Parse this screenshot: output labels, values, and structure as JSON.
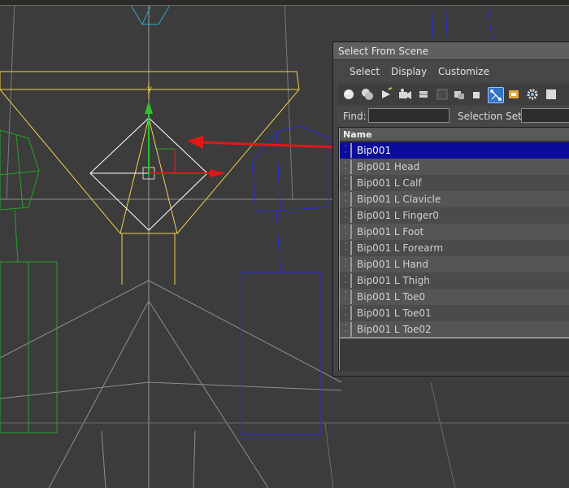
{
  "dialog": {
    "title": "Select From Scene",
    "menu": [
      "Select",
      "Display",
      "Customize"
    ],
    "find_label": "Find:",
    "find_value": "",
    "selection_set_label": "Selection Set:",
    "selection_set_value": "",
    "column_header": "Name",
    "rows": [
      "Bip001",
      "Bip001 Head",
      "Bip001 L Calf",
      "Bip001 L Clavicle",
      "Bip001 L Finger0",
      "Bip001 L Foot",
      "Bip001 L Forearm",
      "Bip001 L Hand",
      "Bip001 L Thigh",
      "Bip001 L Toe0",
      "Bip001 L Toe01",
      "Bip001 L Toe02"
    ],
    "selected_row": "Bip001"
  },
  "toolbar_icons": [
    "sphere-icon",
    "multi-sphere-icon",
    "light-icon",
    "camera-icon",
    "helper-icon",
    "spacewarp-icon",
    "group-icon",
    "bone-hierarchy-icon",
    "bone-icon",
    "xref-icon",
    "gear-icon"
  ],
  "viewport": {
    "gizmo_axis_label": "y",
    "colors": {
      "background": "#3c3c3c",
      "grid": "#8e8e8e",
      "selected_bone": "#f0d050",
      "left_bones": "#2aa02a",
      "right_bones": "#2c2ce0",
      "arrow": "#e01818",
      "gizmo": "#ffffff",
      "head": "#2aa8c8"
    }
  }
}
